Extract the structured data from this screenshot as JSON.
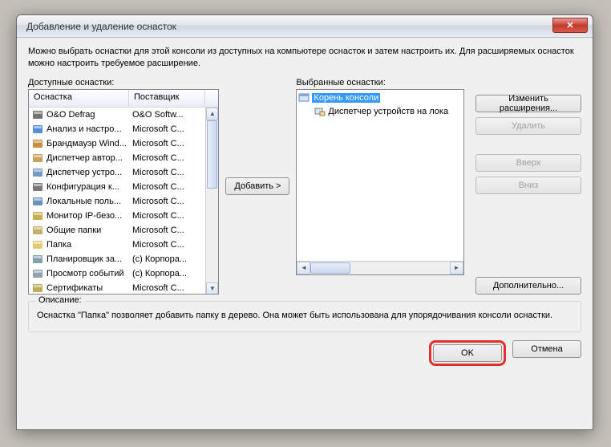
{
  "window": {
    "title": "Добавление и удаление оснасток",
    "close_icon": "✕"
  },
  "intro": "Можно выбрать оснастки для этой консоли из доступных на компьютере оснасток и затем настроить их. Для расширяемых оснасток можно настроить требуемое расширение.",
  "available": {
    "label": "Доступные оснастки:",
    "col_snapin": "Оснастка",
    "col_vendor": "Поставщик",
    "rows": [
      {
        "name": "O&O Defrag",
        "vendor": "O&O Softw..."
      },
      {
        "name": "Анализ и настро...",
        "vendor": "Microsoft C..."
      },
      {
        "name": "Брандмауэр Wind...",
        "vendor": "Microsoft C..."
      },
      {
        "name": "Диспетчер автор...",
        "vendor": "Microsoft C..."
      },
      {
        "name": "Диспетчер устро...",
        "vendor": "Microsoft C..."
      },
      {
        "name": "Конфигурация к...",
        "vendor": "Microsoft C..."
      },
      {
        "name": "Локальные поль...",
        "vendor": "Microsoft C..."
      },
      {
        "name": "Монитор IP-безо...",
        "vendor": "Microsoft C..."
      },
      {
        "name": "Общие папки",
        "vendor": "Microsoft C..."
      },
      {
        "name": "Папка",
        "vendor": "Microsoft C..."
      },
      {
        "name": "Планировщик за...",
        "vendor": "(c) Корпора..."
      },
      {
        "name": "Просмотр событий",
        "vendor": "(c) Корпора..."
      },
      {
        "name": "Сертификаты",
        "vendor": "Microsoft C..."
      }
    ]
  },
  "selected": {
    "label": "Выбранные оснастки:",
    "root": "Корень консоли",
    "items": [
      {
        "name": "Диспетчер устройств на лока"
      }
    ]
  },
  "buttons": {
    "add": "Добавить >",
    "edit_ext": "Изменить расширения...",
    "remove": "Удалить",
    "up": "Вверх",
    "down": "Вниз",
    "advanced": "Дополнительно...",
    "ok": "OK",
    "cancel": "Отмена"
  },
  "description": {
    "label": "Описание:",
    "text": "Оснастка \"Папка\" позволяет добавить папку в дерево. Она может быть использована для упорядочивания консоли оснастки."
  },
  "icons": {
    "defrag": "#5a5a5a",
    "analysis": "#3a7ad0",
    "firewall": "#c07a20",
    "auth": "#c09040",
    "device": "#5a8ac0",
    "config": "#606060",
    "users": "#5080b0",
    "ipmon": "#c0a030",
    "shared": "#c0a050",
    "folder": "#e0c060",
    "sched": "#7090a0",
    "event": "#8090a0",
    "cert": "#b0a040",
    "root": "#5a8ac0"
  }
}
